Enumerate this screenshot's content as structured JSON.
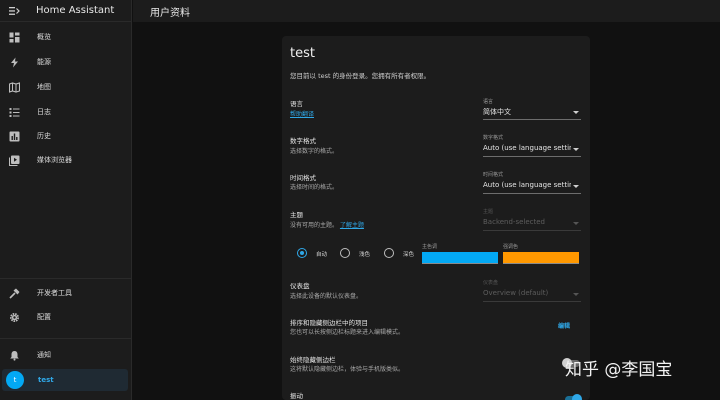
{
  "app": {
    "title": "Home Assistant"
  },
  "sidebar": {
    "items": [
      {
        "label": "概览",
        "icon": "dashboard-icon"
      },
      {
        "label": "能源",
        "icon": "lightning-icon"
      },
      {
        "label": "地图",
        "icon": "map-icon"
      },
      {
        "label": "日志",
        "icon": "list-icon"
      },
      {
        "label": "历史",
        "icon": "chart-icon"
      },
      {
        "label": "媒体浏览器",
        "icon": "play-box-icon"
      }
    ],
    "developer_tools": "开发者工具",
    "settings": "配置",
    "notifications": "通知",
    "user": {
      "name": "test",
      "initial": "t"
    }
  },
  "header": {
    "title": "用户资料"
  },
  "profile": {
    "name": "test",
    "subtitle": "您目前以 test 的身份登录。您拥有所有者权限。",
    "language": {
      "title": "语言",
      "link": "帮助翻译",
      "select_label": "语言",
      "value": "简体中文"
    },
    "number_format": {
      "title": "数字格式",
      "desc": "选择数字的格式。",
      "select_label": "数字格式",
      "value": "Auto (use language setting)"
    },
    "time_format": {
      "title": "时间格式",
      "desc": "选择时间的格式。",
      "select_label": "时间格式",
      "value": "Auto (use language setting)"
    },
    "theme": {
      "title": "主题",
      "desc": "没有可用的主题。",
      "link": "了解主题",
      "select_label": "主题",
      "value": "Backend-selected",
      "modes": [
        "自动",
        "浅色",
        "深色"
      ],
      "selected_mode": "自动",
      "primary_label": "主色调",
      "primary_color": "#03a9f4",
      "accent_label": "强调色",
      "accent_color": "#ff9800"
    },
    "dashboard": {
      "title": "仪表盘",
      "desc": "选择此设备的默认仪表盘。",
      "select_label": "仪表盘",
      "value": "Overview (default)"
    },
    "sidebar_order": {
      "title": "排序和隐藏侧边栏中的项目",
      "desc": "您也可以长按侧边栏标题来进入编辑模式。",
      "button": "编辑"
    },
    "always_hide_sidebar": {
      "title": "始终隐藏侧边栏",
      "desc": "这将默认隐藏侧边栏，体验与手机版类似。",
      "enabled": false
    },
    "vibrate": {
      "title": "振动",
      "enabled": true
    }
  },
  "watermark": "知乎 @李国宝",
  "colors": {
    "accent": "#2fa8e8",
    "background": "#111111",
    "card": "#1c1c1c"
  }
}
